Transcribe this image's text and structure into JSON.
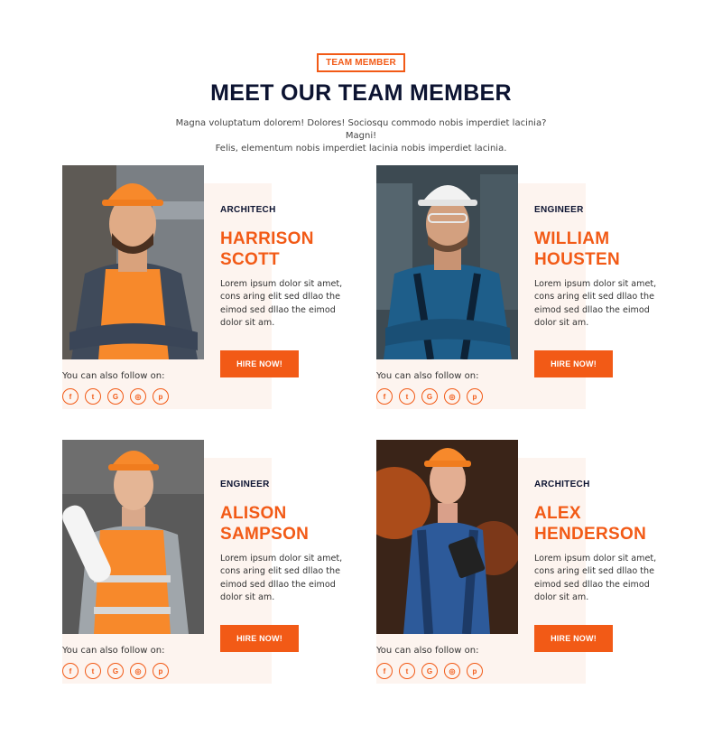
{
  "section": {
    "badge": "TEAM MEMBER",
    "title": "MEET OUR TEAM MEMBER",
    "intro_line1": "Magna voluptatum dolorem! Dolores! Sociosqu commodo nobis imperdiet lacinia? Magni!",
    "intro_line2": "Felis, elementum nobis imperdiet lacinia nobis imperdiet lacinia."
  },
  "members": [
    {
      "role": "ARCHITECH",
      "name_line1": "HARRISON",
      "name_line2": "SCOTT",
      "description": "Lorem ipsum dolor sit amet, cons aring elit sed dllao the eimod sed dllao the eimod dolor sit am.",
      "button": "HIRE NOW!",
      "follow_text": "You can also follow on:"
    },
    {
      "role": "ENGINEER",
      "name_line1": "WILLIAM",
      "name_line2": "HOUSTEN",
      "description": "Lorem ipsum dolor sit amet, cons aring elit sed dllao the eimod sed dllao the eimod dolor sit am.",
      "button": "HIRE NOW!",
      "follow_text": "You can also follow on:"
    },
    {
      "role": "ENGINEER",
      "name_line1": "ALISON",
      "name_line2": "SAMPSON",
      "description": "Lorem ipsum dolor sit amet, cons aring elit sed dllao the eimod sed dllao the eimod dolor sit am.",
      "button": "HIRE NOW!",
      "follow_text": "You can also follow on:"
    },
    {
      "role": "ARCHITECH",
      "name_line1": "ALEX",
      "name_line2": "HENDERSON",
      "description": "Lorem ipsum dolor sit amet, cons aring elit sed dllao the eimod sed dllao the eimod dolor sit am.",
      "button": "HIRE NOW!",
      "follow_text": "You can also follow on:"
    }
  ],
  "social_icons": [
    {
      "name": "facebook-icon",
      "glyph": "f"
    },
    {
      "name": "twitter-icon",
      "glyph": "t"
    },
    {
      "name": "google-icon",
      "glyph": "G"
    },
    {
      "name": "instagram-icon",
      "glyph": "◎"
    },
    {
      "name": "pinterest-icon",
      "glyph": "p"
    }
  ],
  "colors": {
    "accent": "#f25a16",
    "heading": "#0c1331",
    "card_bg": "#fdf4ef"
  }
}
